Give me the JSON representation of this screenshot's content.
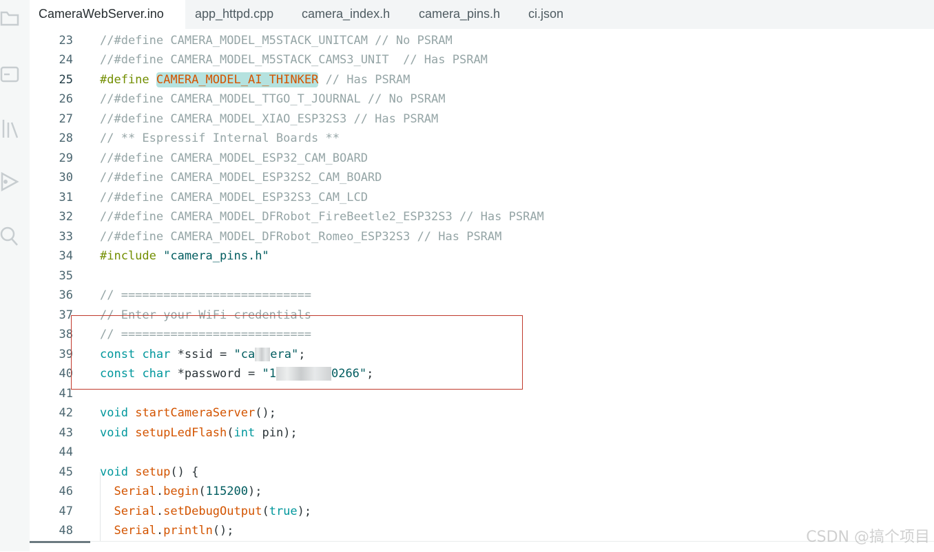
{
  "activity_bar": {
    "icons": [
      "folder-icon",
      "board-manager-icon",
      "library-manager-icon",
      "debug-icon",
      "search-icon"
    ]
  },
  "tabs": [
    {
      "label": "CameraWebServer.ino",
      "active": true
    },
    {
      "label": "app_httpd.cpp",
      "active": false
    },
    {
      "label": "camera_index.h",
      "active": false
    },
    {
      "label": "camera_pins.h",
      "active": false
    },
    {
      "label": "ci.json",
      "active": false
    }
  ],
  "editor": {
    "active_line": "25",
    "lines": [
      {
        "n": "23",
        "t": "//#define CAMERA_MODEL_M5STACK_UNITCAM // No PSRAM"
      },
      {
        "n": "24",
        "t": "//#define CAMERA_MODEL_M5STACK_CAMS3_UNIT  // Has PSRAM"
      },
      {
        "n": "25",
        "t": "#define CAMERA_MODEL_AI_THINKER // Has PSRAM"
      },
      {
        "n": "26",
        "t": "//#define CAMERA_MODEL_TTGO_T_JOURNAL // No PSRAM"
      },
      {
        "n": "27",
        "t": "//#define CAMERA_MODEL_XIAO_ESP32S3 // Has PSRAM"
      },
      {
        "n": "28",
        "t": "// ** Espressif Internal Boards **"
      },
      {
        "n": "29",
        "t": "//#define CAMERA_MODEL_ESP32_CAM_BOARD"
      },
      {
        "n": "30",
        "t": "//#define CAMERA_MODEL_ESP32S2_CAM_BOARD"
      },
      {
        "n": "31",
        "t": "//#define CAMERA_MODEL_ESP32S3_CAM_LCD"
      },
      {
        "n": "32",
        "t": "//#define CAMERA_MODEL_DFRobot_FireBeetle2_ESP32S3 // Has PSRAM"
      },
      {
        "n": "33",
        "t": "//#define CAMERA_MODEL_DFRobot_Romeo_ESP32S3 // Has PSRAM"
      },
      {
        "n": "34",
        "t": "#include \"camera_pins.h\""
      },
      {
        "n": "35",
        "t": ""
      },
      {
        "n": "36",
        "t": "// ==========================="
      },
      {
        "n": "37",
        "t": "// Enter your WiFi credentials"
      },
      {
        "n": "38",
        "t": "// ==========================="
      },
      {
        "n": "39",
        "t": "const char *ssid = \"ca  era\";"
      },
      {
        "n": "40",
        "t": "const char *password = \"1        0266\";"
      },
      {
        "n": "41",
        "t": ""
      },
      {
        "n": "42",
        "t": "void startCameraServer();"
      },
      {
        "n": "43",
        "t": "void setupLedFlash(int pin);"
      },
      {
        "n": "44",
        "t": ""
      },
      {
        "n": "45",
        "t": "void setup() {"
      },
      {
        "n": "46",
        "t": "  Serial.begin(115200);"
      },
      {
        "n": "47",
        "t": "  Serial.setDebugOutput(true);"
      },
      {
        "n": "48",
        "t": "  Serial.println();"
      }
    ]
  },
  "code_parts": {
    "l23": "//#define CAMERA_MODEL_M5STACK_UNITCAM // No PSRAM",
    "l24": "//#define CAMERA_MODEL_M5STACK_CAMS3_UNIT  // Has PSRAM",
    "l25_pp": "#define",
    "l25_macro": "CAMERA_MODEL_AI_THINKER",
    "l25_comment": "// Has PSRAM",
    "l26": "//#define CAMERA_MODEL_TTGO_T_JOURNAL // No PSRAM",
    "l27": "//#define CAMERA_MODEL_XIAO_ESP32S3 // Has PSRAM",
    "l28": "// ** Espressif Internal Boards **",
    "l29": "//#define CAMERA_MODEL_ESP32_CAM_BOARD",
    "l30": "//#define CAMERA_MODEL_ESP32S2_CAM_BOARD",
    "l31": "//#define CAMERA_MODEL_ESP32S3_CAM_LCD",
    "l32": "//#define CAMERA_MODEL_DFRobot_FireBeetle2_ESP32S3 // Has PSRAM",
    "l33": "//#define CAMERA_MODEL_DFRobot_Romeo_ESP32S3 // Has PSRAM",
    "l34_pp": "#include",
    "l34_str": "\"camera_pins.h\"",
    "l36": "// ===========================",
    "l37": "// Enter your WiFi credentials",
    "l38": "// ===========================",
    "const": "const",
    "char": "char",
    "l39_var": "*ssid =",
    "l39_str_a": "\"ca",
    "l39_str_b": "era\"",
    "l40_var": "*password =",
    "l40_str_a": "\"1",
    "l40_str_b": "0266\"",
    "semi": ";",
    "void": "void",
    "l42_fn": "startCameraServer",
    "l42_rest": "();",
    "l43_fn": "setupLedFlash",
    "l43_open": "(",
    "l43_int": "int",
    "l43_rest": "pin);",
    "l45_fn": "setup",
    "l45_rest": "() {",
    "serial": "Serial",
    "dot": ".",
    "l46_fn": "begin",
    "l46_open": "(",
    "l46_num": "115200",
    "l46_close": ");",
    "l47_fn": "setDebugOutput",
    "l47_open": "(",
    "l47_true": "true",
    "l47_close": ");",
    "l48_fn": "println",
    "l48_rest": "();"
  },
  "watermark": "CSDN @搞个项目",
  "colors": {
    "comment": "#95a5a6",
    "preprocessor": "#728e00",
    "macro_highlight_bg": "#b5e2df",
    "function": "#d35400",
    "type_keyword": "#00979c",
    "string": "#005c5f",
    "annotation_box": "#c0392b"
  }
}
